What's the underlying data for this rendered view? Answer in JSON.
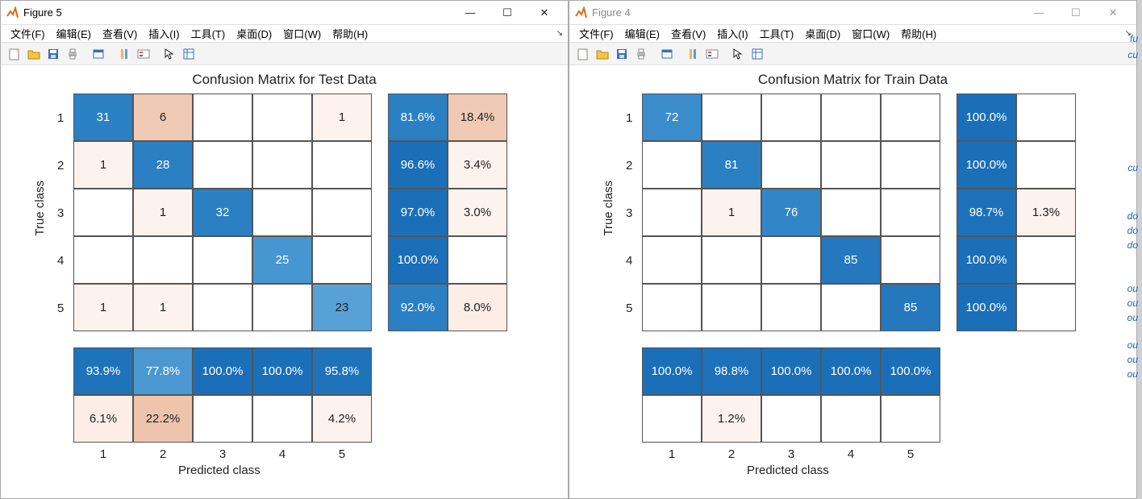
{
  "left_window": {
    "title": "Figure 5",
    "menus": {
      "file": "文件(F)",
      "edit": "编辑(E)",
      "view": "查看(V)",
      "insert": "插入(I)",
      "tools": "工具(T)",
      "desktop": "桌面(D)",
      "window": "窗口(W)",
      "help": "帮助(H)"
    }
  },
  "right_window": {
    "title": "Figure 4",
    "menus": {
      "file": "文件(F)",
      "edit": "编辑(E)",
      "view": "查看(V)",
      "insert": "插入(I)",
      "tools": "工具(T)",
      "desktop": "桌面(D)",
      "window": "窗口(W)",
      "help": "帮助(H)"
    }
  },
  "side_snippets": [
    "fu",
    "cu",
    "cu",
    "do",
    "do",
    "do",
    "ou",
    "ou",
    "ou",
    "ou",
    "ou",
    "ou"
  ],
  "chart_data": [
    {
      "type": "heatmap",
      "title": "Confusion Matrix for Test Data",
      "xlabel": "Predicted class",
      "ylabel": "True class",
      "classes": [
        "1",
        "2",
        "3",
        "4",
        "5"
      ],
      "counts": [
        [
          "31",
          "6",
          "",
          "",
          "1"
        ],
        [
          "1",
          "28",
          "",
          "",
          ""
        ],
        [
          "",
          "1",
          "32",
          "",
          ""
        ],
        [
          "",
          "",
          "",
          "25",
          ""
        ],
        [
          "1",
          "1",
          "",
          "",
          "23"
        ]
      ],
      "row_pct": [
        [
          "81.6%",
          "18.4%"
        ],
        [
          "96.6%",
          "3.4%"
        ],
        [
          "97.0%",
          "3.0%"
        ],
        [
          "100.0%",
          ""
        ],
        [
          "92.0%",
          "8.0%"
        ]
      ],
      "col_pct": [
        [
          "93.9%",
          "77.8%",
          "100.0%",
          "100.0%",
          "95.8%"
        ],
        [
          "6.1%",
          "22.2%",
          "",
          "",
          "4.2%"
        ]
      ],
      "cell_colors": [
        [
          "#2b80c4",
          "#f0c9b4",
          "#ffffff",
          "#ffffff",
          "#fdf3ee"
        ],
        [
          "#fdf3ee",
          "#2b80c4",
          "#ffffff",
          "#ffffff",
          "#ffffff"
        ],
        [
          "#ffffff",
          "#fdf3ee",
          "#2b80c4",
          "#ffffff",
          "#ffffff"
        ],
        [
          "#ffffff",
          "#ffffff",
          "#ffffff",
          "#4696d2",
          "#ffffff"
        ],
        [
          "#fdf3ee",
          "#fdf3ee",
          "#ffffff",
          "#ffffff",
          "#58a1d6"
        ]
      ],
      "row_pct_colors": [
        [
          "#2b80c4",
          "#f0c9b4"
        ],
        [
          "#1b6fb8",
          "#fdf3ee"
        ],
        [
          "#1b6fb8",
          "#fdf3ee"
        ],
        [
          "#1b6fb8",
          "#ffffff"
        ],
        [
          "#2b80c4",
          "#fceee6"
        ]
      ],
      "col_pct_colors": [
        [
          "#1e73bb",
          "#4b97d1",
          "#1b6fb8",
          "#1b6fb8",
          "#1e73bb"
        ],
        [
          "#fceee6",
          "#eec4ad",
          "#ffffff",
          "#ffffff",
          "#fdf3ee"
        ]
      ]
    },
    {
      "type": "heatmap",
      "title": "Confusion Matrix for Train Data",
      "xlabel": "Predicted class",
      "ylabel": "True class",
      "classes": [
        "1",
        "2",
        "3",
        "4",
        "5"
      ],
      "counts": [
        [
          "72",
          "",
          "",
          "",
          ""
        ],
        [
          "",
          "81",
          "",
          "",
          ""
        ],
        [
          "",
          "1",
          "76",
          "",
          ""
        ],
        [
          "",
          "",
          "",
          "85",
          ""
        ],
        [
          "",
          "",
          "",
          "",
          "85"
        ]
      ],
      "row_pct": [
        [
          "100.0%",
          ""
        ],
        [
          "100.0%",
          ""
        ],
        [
          "98.7%",
          "1.3%"
        ],
        [
          "100.0%",
          ""
        ],
        [
          "100.0%",
          ""
        ]
      ],
      "col_pct": [
        [
          "100.0%",
          "98.8%",
          "100.0%",
          "100.0%",
          "100.0%"
        ],
        [
          "",
          "1.2%",
          "",
          "",
          ""
        ]
      ],
      "cell_colors": [
        [
          "#3b8ccb",
          "#ffffff",
          "#ffffff",
          "#ffffff",
          "#ffffff"
        ],
        [
          "#ffffff",
          "#2b80c4",
          "#ffffff",
          "#ffffff",
          "#ffffff"
        ],
        [
          "#ffffff",
          "#fdf3ee",
          "#3286c8",
          "#ffffff",
          "#ffffff"
        ],
        [
          "#ffffff",
          "#ffffff",
          "#ffffff",
          "#2578be",
          "#ffffff"
        ],
        [
          "#ffffff",
          "#ffffff",
          "#ffffff",
          "#ffffff",
          "#2578be"
        ]
      ],
      "row_pct_colors": [
        [
          "#1b6fb8",
          "#ffffff"
        ],
        [
          "#1b6fb8",
          "#ffffff"
        ],
        [
          "#1d71ba",
          "#fdf3ee"
        ],
        [
          "#1b6fb8",
          "#ffffff"
        ],
        [
          "#1b6fb8",
          "#ffffff"
        ]
      ],
      "col_pct_colors": [
        [
          "#1b6fb8",
          "#1d71ba",
          "#1b6fb8",
          "#1b6fb8",
          "#1b6fb8"
        ],
        [
          "#ffffff",
          "#fdf3ee",
          "#ffffff",
          "#ffffff",
          "#ffffff"
        ]
      ]
    }
  ]
}
